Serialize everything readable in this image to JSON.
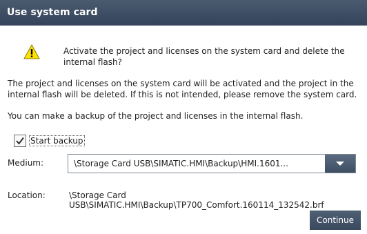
{
  "dialog": {
    "title": "Use system card"
  },
  "message": {
    "main": "Activate the project and licenses on the system card and delete the internal flash?",
    "info": "The project and licenses on the system card will be activated and the project in the internal flash will be deleted. If this is not intended, please remove the system card.",
    "backup": "You can make a backup of the project and licenses in the internal flash."
  },
  "backup_option": {
    "label": "Start backup",
    "checked": true
  },
  "medium": {
    "label": "Medium:",
    "value": "\\Storage Card USB\\SIMATIC.HMI\\Backup\\HMI.1601..."
  },
  "location": {
    "label": "Location:",
    "value": "\\Storage Card USB\\SIMATIC.HMI\\Backup\\TP700_Comfort.160114_132542.brf"
  },
  "actions": {
    "continue_label": "Continue"
  },
  "icons": {
    "warning": "warning-icon",
    "checkmark": "checkmark-icon",
    "dropdown": "chevron-down-icon"
  },
  "colors": {
    "titlebar": "#3c4b60",
    "button": "#45556a",
    "warning_fill": "#ffe200"
  }
}
